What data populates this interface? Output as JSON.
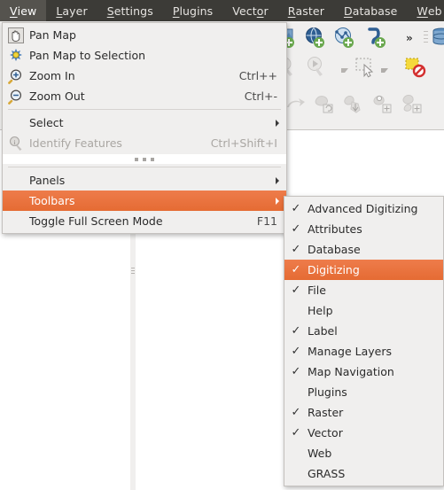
{
  "menubar": {
    "items": [
      {
        "label": "View",
        "mnemonic": "V",
        "active": true
      },
      {
        "label": "Layer",
        "mnemonic": "L",
        "active": false
      },
      {
        "label": "Settings",
        "mnemonic": "S",
        "active": false
      },
      {
        "label": "Plugins",
        "mnemonic": "P",
        "active": false
      },
      {
        "label": "Vector",
        "mnemonic": "o",
        "active": false
      },
      {
        "label": "Raster",
        "mnemonic": "R",
        "active": false
      },
      {
        "label": "Database",
        "mnemonic": "D",
        "active": false
      },
      {
        "label": "Web",
        "mnemonic": "W",
        "active": false
      }
    ]
  },
  "view_menu": {
    "items": [
      {
        "label": "Pan Map",
        "shortcut": "",
        "icon": "pan-hand-icon",
        "has_submenu": false,
        "disabled": false,
        "selected": false
      },
      {
        "label": "Pan Map to Selection",
        "shortcut": "",
        "icon": "pan-to-selection-icon",
        "has_submenu": false,
        "disabled": false,
        "selected": false
      },
      {
        "label": "Zoom In",
        "shortcut": "Ctrl++",
        "icon": "zoom-in-icon",
        "has_submenu": false,
        "disabled": false,
        "selected": false
      },
      {
        "label": "Zoom Out",
        "shortcut": "Ctrl+-",
        "icon": "zoom-out-icon",
        "has_submenu": false,
        "disabled": false,
        "selected": false
      },
      {
        "label": "Select",
        "shortcut": "",
        "icon": "",
        "has_submenu": true,
        "disabled": false,
        "selected": false
      },
      {
        "label": "Identify Features",
        "shortcut": "Ctrl+Shift+I",
        "icon": "identify-icon",
        "has_submenu": false,
        "disabled": true,
        "selected": false
      },
      {
        "label": "Panels",
        "shortcut": "",
        "icon": "",
        "has_submenu": true,
        "disabled": false,
        "selected": false
      },
      {
        "label": "Toolbars",
        "shortcut": "",
        "icon": "",
        "has_submenu": true,
        "disabled": false,
        "selected": true
      },
      {
        "label": "Toggle Full Screen Mode",
        "shortcut": "F11",
        "icon": "",
        "has_submenu": false,
        "disabled": false,
        "selected": false
      }
    ]
  },
  "toolbars_submenu": {
    "items": [
      {
        "label": "Advanced Digitizing",
        "checked": true,
        "selected": false
      },
      {
        "label": "Attributes",
        "checked": true,
        "selected": false
      },
      {
        "label": "Database",
        "checked": true,
        "selected": false
      },
      {
        "label": "Digitizing",
        "checked": true,
        "selected": true
      },
      {
        "label": "File",
        "checked": true,
        "selected": false
      },
      {
        "label": "Help",
        "checked": false,
        "selected": false
      },
      {
        "label": "Label",
        "checked": true,
        "selected": false
      },
      {
        "label": "Manage Layers",
        "checked": true,
        "selected": false
      },
      {
        "label": "Map Navigation",
        "checked": true,
        "selected": false
      },
      {
        "label": "Plugins",
        "checked": false,
        "selected": false
      },
      {
        "label": "Raster",
        "checked": true,
        "selected": false
      },
      {
        "label": "Vector",
        "checked": true,
        "selected": false
      },
      {
        "label": "Web",
        "checked": false,
        "selected": false
      },
      {
        "label": "GRASS",
        "checked": false,
        "selected": false
      }
    ],
    "check_glyph": "✓"
  },
  "toolbar_overflow": {
    "label": "»"
  },
  "colors": {
    "menubar_bg": "#3c3b37",
    "menubar_active_bg": "#55534e",
    "menu_bg": "#f0efee",
    "highlight": "#eb7442",
    "text": "#2b2b2b",
    "disabled_text": "#a9a6a2",
    "canvas": "#ffffff"
  }
}
